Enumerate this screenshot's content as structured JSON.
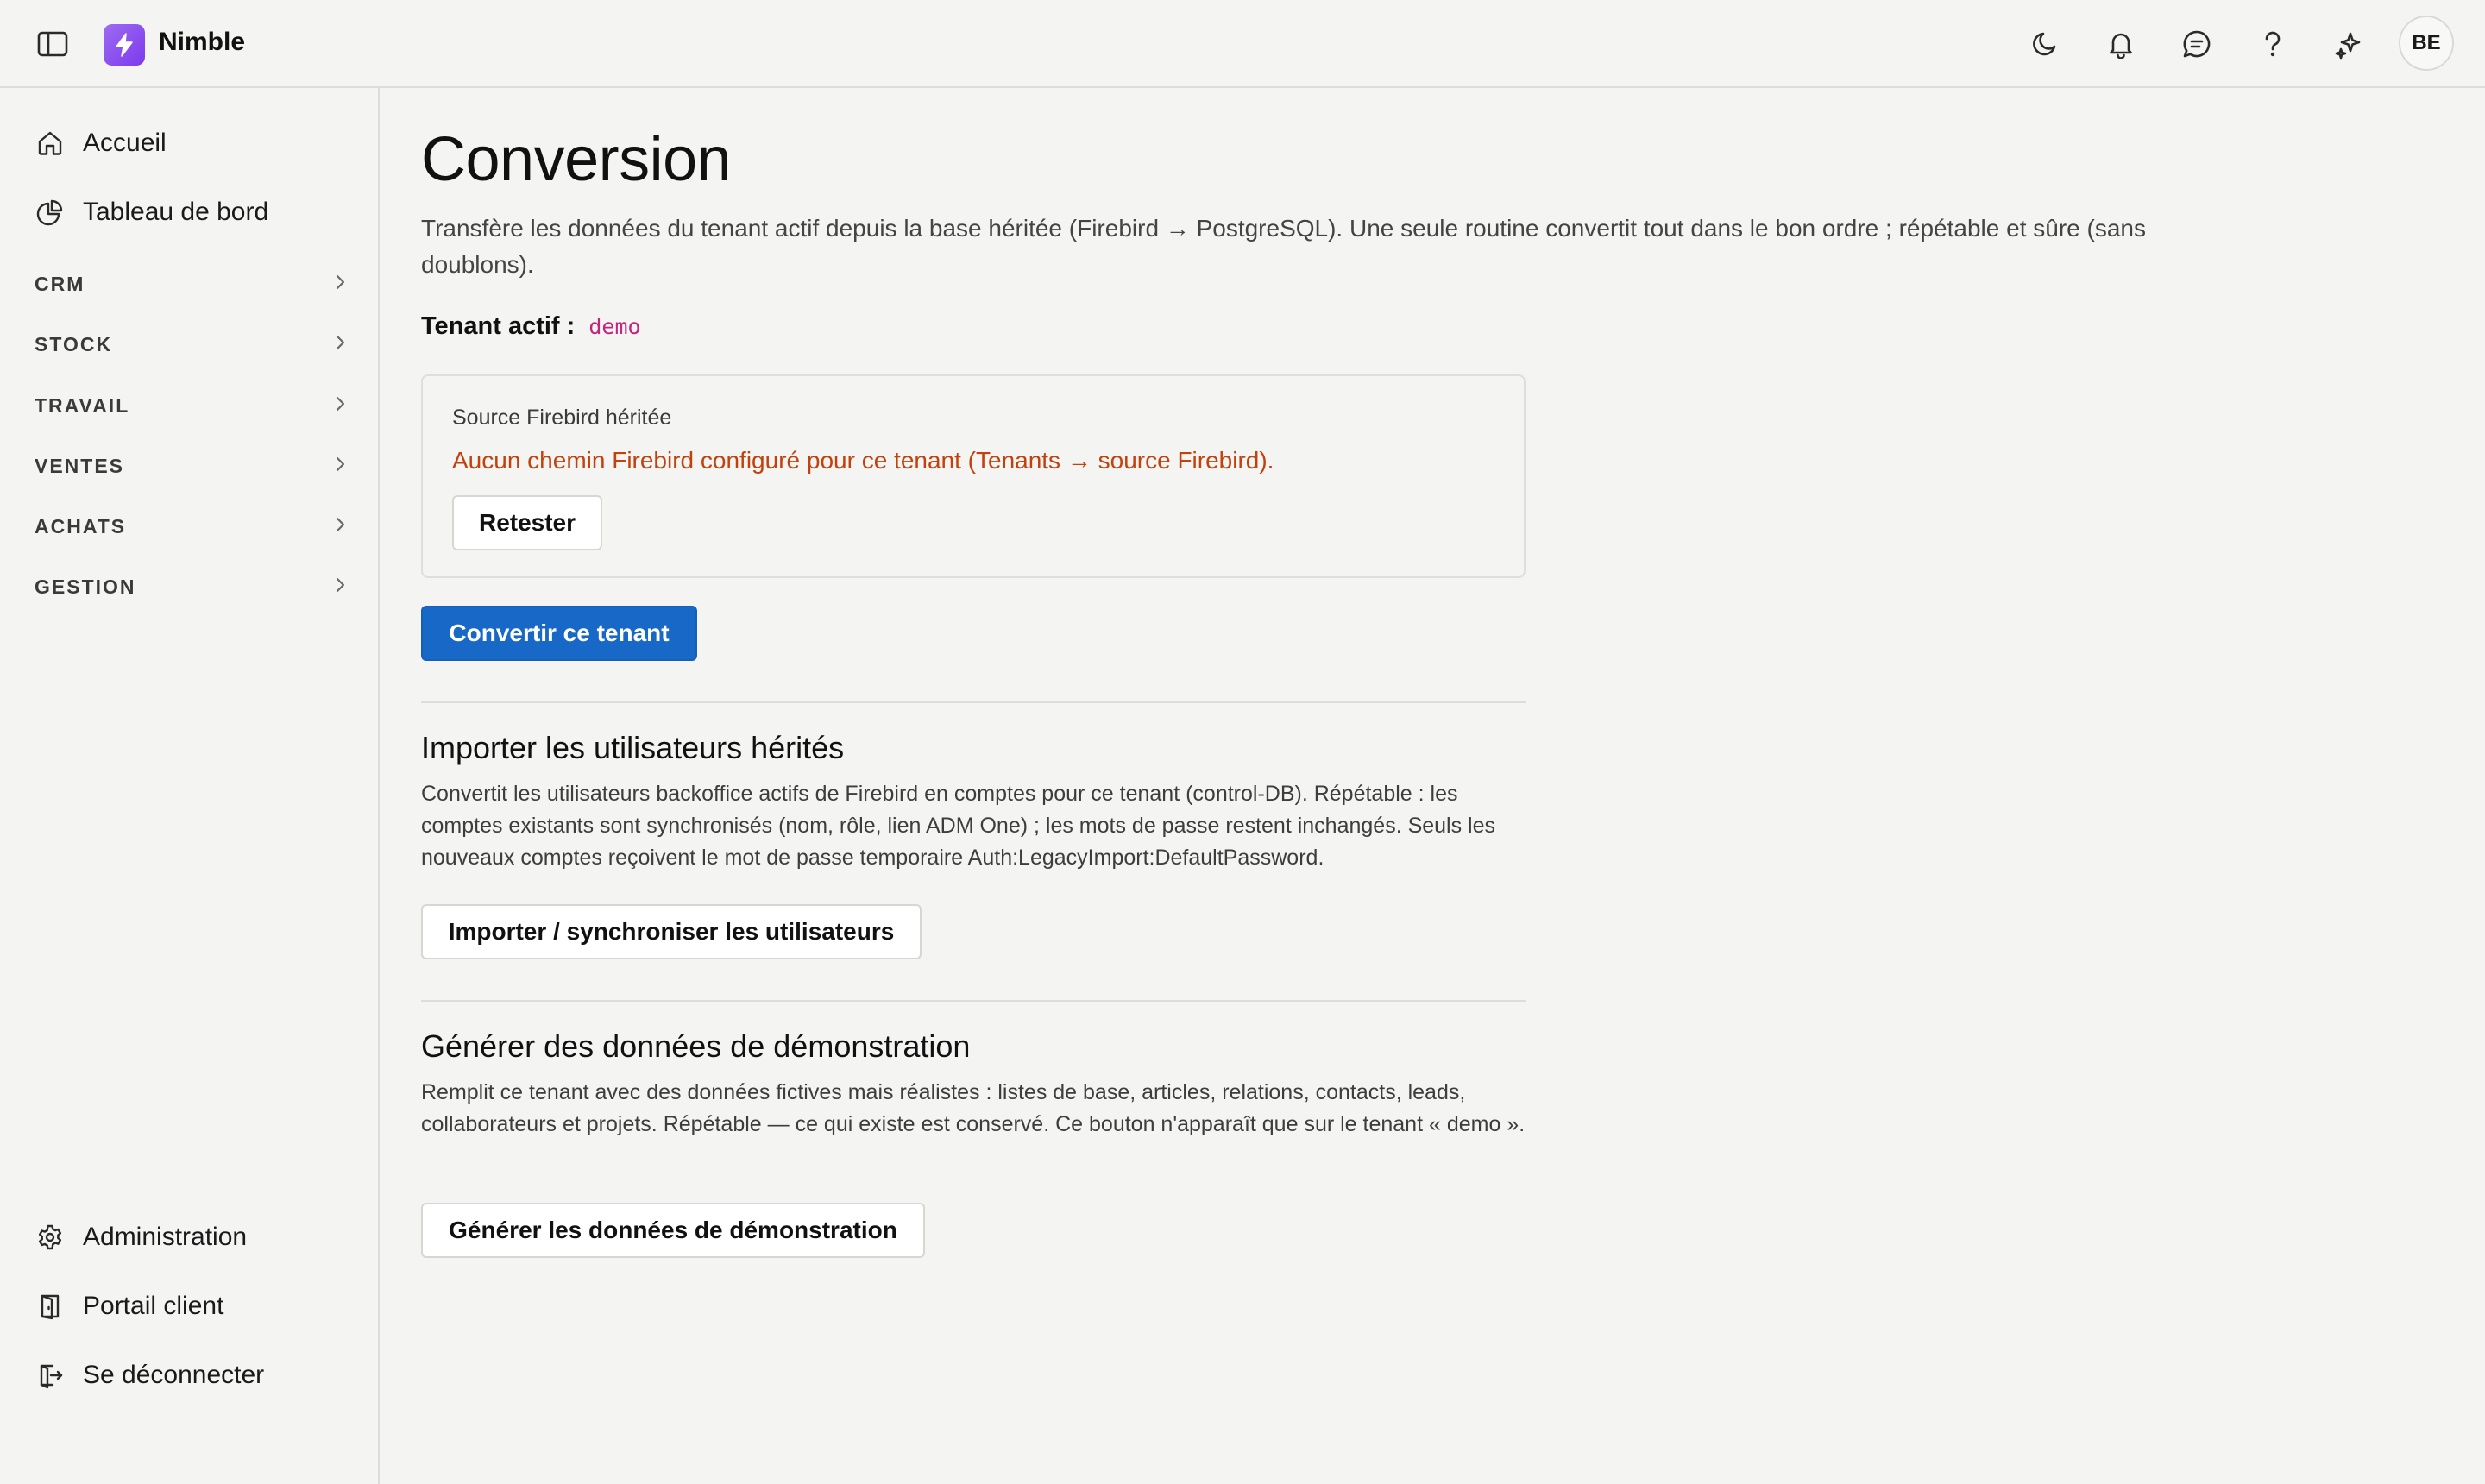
{
  "app": {
    "name": "Nimble",
    "user_initials": "BE"
  },
  "topbar": {
    "icons": [
      "sidebar-toggle-icon",
      "moon-icon",
      "bell-icon",
      "chat-icon",
      "help-icon",
      "sparkles-icon"
    ]
  },
  "sidebar": {
    "top_items": [
      {
        "label": "Accueil",
        "icon": "home-icon"
      },
      {
        "label": "Tableau de bord",
        "icon": "pie-chart-icon"
      }
    ],
    "groups": [
      {
        "label": "CRM"
      },
      {
        "label": "STOCK"
      },
      {
        "label": "TRAVAIL"
      },
      {
        "label": "VENTES"
      },
      {
        "label": "ACHATS"
      },
      {
        "label": "GESTION"
      }
    ],
    "bottom_items": [
      {
        "label": "Administration",
        "icon": "gear-icon"
      },
      {
        "label": "Portail client",
        "icon": "door-icon"
      },
      {
        "label": "Se déconnecter",
        "icon": "logout-icon"
      }
    ]
  },
  "main": {
    "title": "Conversion",
    "description": "Transfère les données du tenant actif depuis la base héritée (Firebird → PostgreSQL). Une seule routine convertit tout dans le bon ordre ; répétable et sûre (sans doublons).",
    "tenant_label": "Tenant actif :",
    "tenant_value": "demo",
    "source_card": {
      "title": "Source Firebird héritée",
      "error": "Aucun chemin Firebird configuré pour ce tenant (Tenants → source Firebird).",
      "retest_label": "Retester"
    },
    "convert_button": "Convertir ce tenant",
    "import_section": {
      "title": "Importer les utilisateurs hérités",
      "description": "Convertit les utilisateurs backoffice actifs de Firebird en comptes pour ce tenant (control-DB). Répétable : les comptes existants sont synchronisés (nom, rôle, lien ADM One) ; les mots de passe restent inchangés. Seuls les nouveaux comptes reçoivent le mot de passe temporaire Auth:LegacyImport:DefaultPassword.",
      "button": "Importer / synchroniser les utilisateurs"
    },
    "demo_section": {
      "title": "Générer des données de démonstration",
      "description": "Remplit ce tenant avec des données fictives mais réalistes : listes de base, articles, relations, contacts, leads, collaborateurs et projets. Répétable — ce qui existe est conservé. Ce bouton n'apparaît que sur le tenant « demo ».",
      "button": "Générer les données de démonstration"
    }
  },
  "colors": {
    "background": "#f4f4f2",
    "primary": "#1868c8",
    "error": "#c2410c",
    "code": "#c0267e",
    "brand": "#8b5cf6"
  }
}
